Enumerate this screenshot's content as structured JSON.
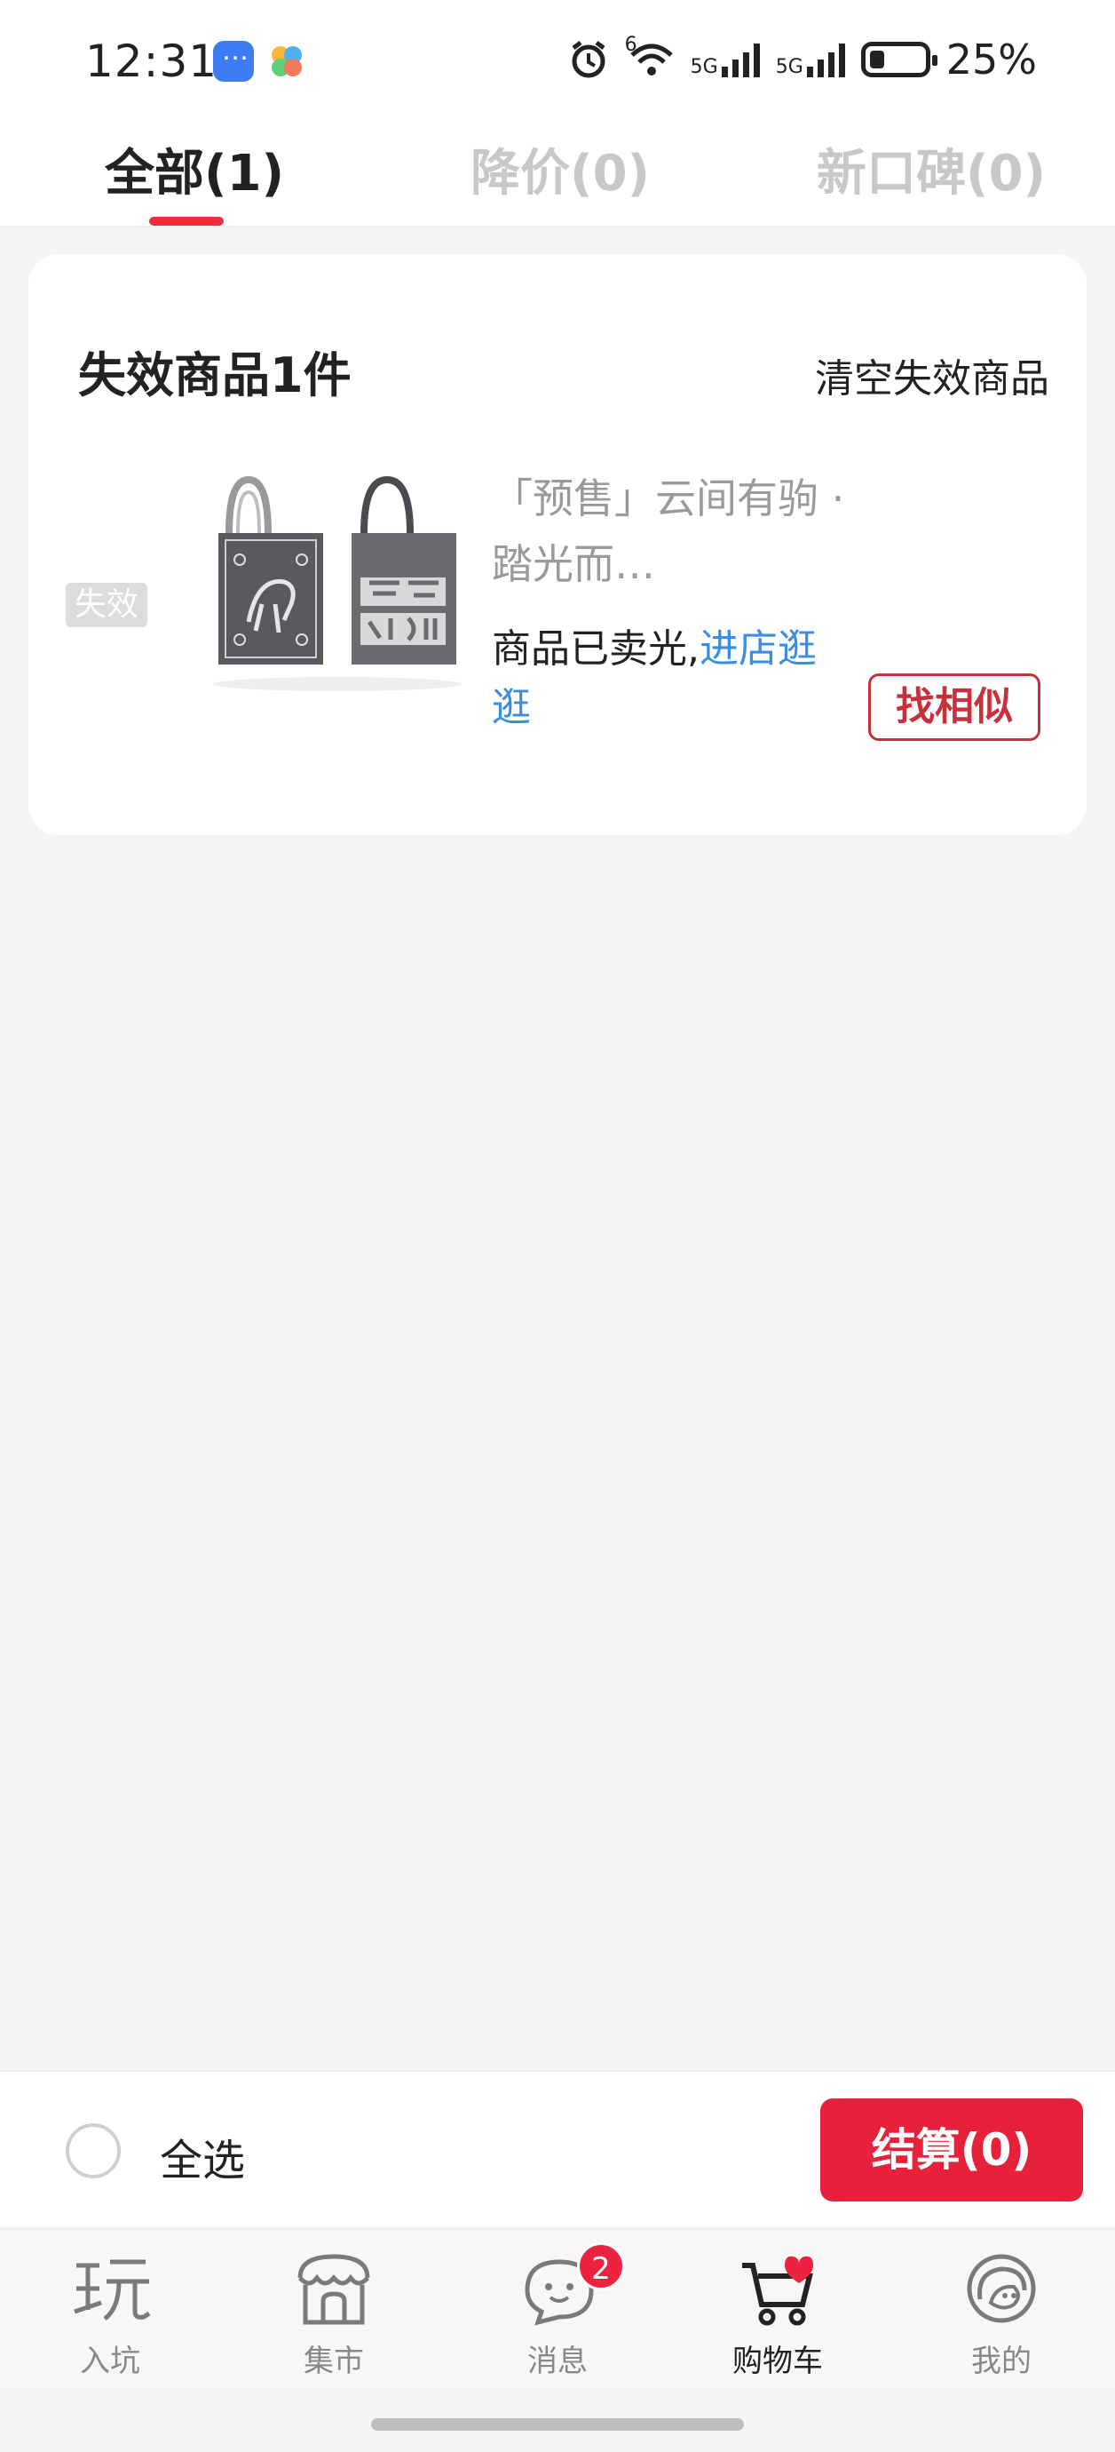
{
  "status_bar": {
    "time": "12:31",
    "battery": "25%",
    "network_1": "5G",
    "network_2": "5G",
    "wifi_sup": "6"
  },
  "tabs": [
    {
      "label": "全部(1)",
      "active": true
    },
    {
      "label": "降价(0)",
      "active": false
    },
    {
      "label": "新口碑(0)",
      "active": false
    }
  ],
  "invalid_section": {
    "title": "失效商品1件",
    "clear_label": "清空失效商品",
    "item": {
      "status_tag": "失效",
      "name": "「预售」云间有驹 · 踏光而…",
      "sold_out_text": "商品已卖光,",
      "shop_link": "进店逛逛",
      "similar_button": "找相似"
    }
  },
  "bottom_bar": {
    "select_all": "全选",
    "checkout": "结算(0)"
  },
  "nav": [
    {
      "label": "入坑",
      "icon": "play-glyph-icon"
    },
    {
      "label": "集市",
      "icon": "shop-icon"
    },
    {
      "label": "消息",
      "icon": "chat-bubble-icon",
      "badge": "2"
    },
    {
      "label": "购物车",
      "icon": "cart-heart-icon",
      "active": true
    },
    {
      "label": "我的",
      "icon": "profile-face-icon"
    }
  ],
  "colors": {
    "accent": "#e8213a",
    "link": "#3b8de0"
  }
}
